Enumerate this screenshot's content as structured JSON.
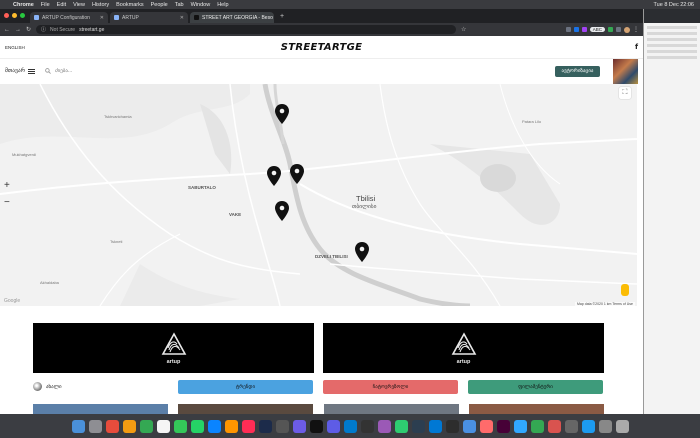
{
  "menubar": {
    "app": "Chrome",
    "items": [
      "File",
      "Edit",
      "View",
      "History",
      "Bookmarks",
      "People",
      "Tab",
      "Window",
      "Help"
    ],
    "clock": "Tue 8 Dec 22:06"
  },
  "browser": {
    "tabs": [
      {
        "title": "ARTUP Configuration"
      },
      {
        "title": "ARTUP"
      },
      {
        "title": "STREET ART GEORGIA - Beso"
      }
    ],
    "address": {
      "security": "Not Secure",
      "url": "streetart.ge"
    },
    "extension_badge": "ABC"
  },
  "site": {
    "language": "ENGLISH",
    "logo": "STREETARTGE",
    "social": "f",
    "menu_label": "მთავარ",
    "search_placeholder": "ძიება...",
    "login_label": "ავტორიზაცია"
  },
  "map": {
    "labels": {
      "tbilisi": "Tbilisi",
      "tbilisi_ka": "თბილისი",
      "saburtalo": "SABURTALO",
      "vake": "VAKE",
      "dzveli": "DZVELI TBILISI",
      "tskneti": "Tskneti",
      "mukhatgverdi": "Mukhatgverdi",
      "tskhvarichamia": "Tskhvarichamia",
      "patara_lilo": "Patara Lilo",
      "akhaldaba": "Akhaldaba"
    },
    "attribution": "Map data ©2020   1 km   Terms of Use",
    "google": "Google",
    "zoom_in": "+",
    "zoom_out": "−"
  },
  "banners": [
    {
      "brand": "artup"
    },
    {
      "brand": "artup"
    }
  ],
  "filters": {
    "new_label": "ახალი",
    "buttons": [
      {
        "label": "ტრენდი",
        "color": "#4ba2e0"
      },
      {
        "label": "ჩატოვრეზოლი",
        "color": "#e46a6a"
      },
      {
        "label": "ფილამენტური",
        "color": "#3e9b7b"
      }
    ]
  }
}
